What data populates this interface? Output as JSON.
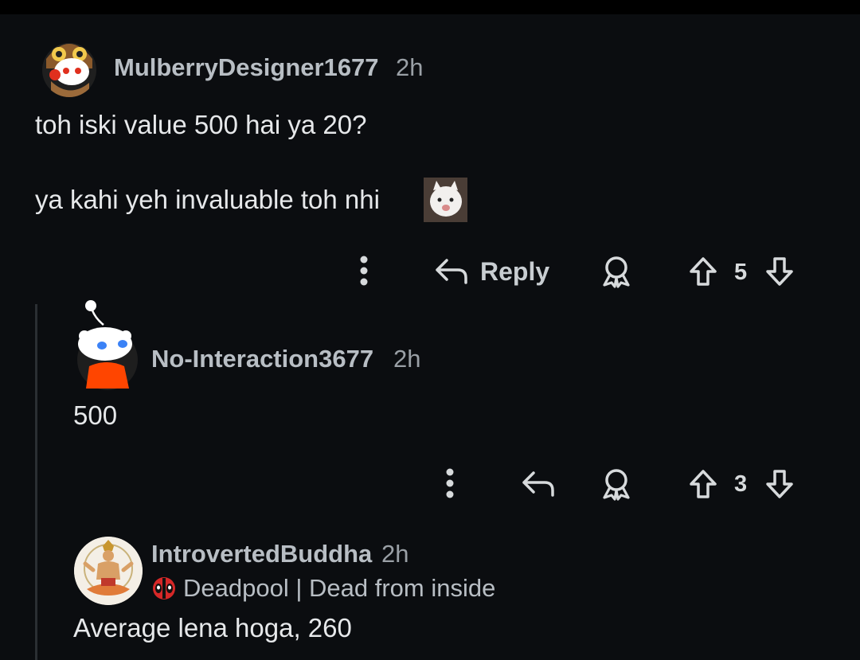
{
  "comments": [
    {
      "username": "MulberryDesigner1677",
      "time": "2h",
      "body_line1": "toh iski value 500 hai ya 20?",
      "body_line2": "ya kahi yeh invaluable toh nhi",
      "actions": {
        "reply_label": "Reply",
        "votes": "5"
      },
      "avatar": "owl-hat-snoo-avatar"
    },
    {
      "username": "No-Interaction3677",
      "time": "2h",
      "body": "500",
      "actions": {
        "votes": "3"
      },
      "avatar": "snoo-avatar"
    },
    {
      "username": "IntrovertedBuddha",
      "time": "2h",
      "flair": "Deadpool | Dead from inside",
      "flair_icon": "deadpool-icon",
      "body": "Average lena hoga, 260",
      "avatar": "meditating-figure-avatar"
    }
  ],
  "colors": {
    "background": "#0b0d10",
    "username": "#b8bec4",
    "text": "#e6e8ea",
    "muted": "#9aa0a6"
  }
}
